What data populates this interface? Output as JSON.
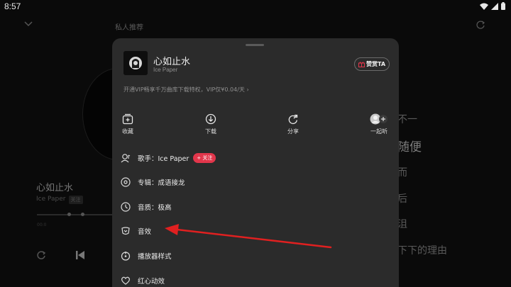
{
  "status": {
    "time": "8:57"
  },
  "background": {
    "top_title": "私人推荐",
    "song_title": "心如止水",
    "artist": "Ice Paper",
    "artist_tag": "关注",
    "time_elapsed": "00:0",
    "lyrics": [
      "不一",
      "随便",
      "而",
      "后",
      "沮",
      "下下的理由"
    ]
  },
  "sheet": {
    "title": "心如止水",
    "subtitle": "Ice Paper",
    "reward_label": "赞赏TA",
    "vip_text": "开通VIP畅享千万曲库下载特权，VIP仅¥0.04/天 ›",
    "actions": [
      {
        "label": "收藏",
        "icon": "add-to-playlist-icon"
      },
      {
        "label": "下载",
        "icon": "download-icon"
      },
      {
        "label": "分享",
        "icon": "share-icon"
      },
      {
        "label": "一起听",
        "icon": "listen-together-icon"
      }
    ],
    "menu": [
      {
        "label": "歌手：Ice Paper",
        "icon": "singer-icon",
        "badge": "+ 关注"
      },
      {
        "label": "专辑：成语接龙",
        "icon": "album-icon"
      },
      {
        "label": "音质：极高",
        "icon": "quality-icon"
      },
      {
        "label": "音效",
        "icon": "sound-effect-icon"
      },
      {
        "label": "播放器样式",
        "icon": "player-style-icon"
      },
      {
        "label": "红心动效",
        "icon": "heart-effect-icon"
      }
    ]
  },
  "colors": {
    "accent": "#e2364b",
    "arrow": "#e02020",
    "sheet_bg": "#2b2b2b"
  }
}
